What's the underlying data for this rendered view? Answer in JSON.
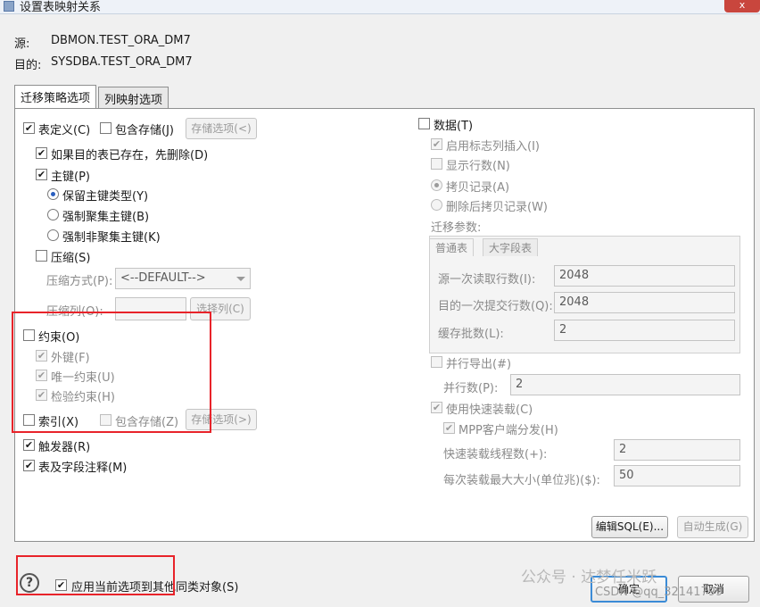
{
  "window": {
    "title": "设置表映射关系",
    "close_label": "x"
  },
  "info": {
    "source_label": "源:",
    "source_value": "DBMON.TEST_ORA_DM7",
    "target_label": "目的:",
    "target_value": "SYSDBA.TEST_ORA_DM7"
  },
  "tabs": [
    {
      "label": "迁移策略选项",
      "active": true
    },
    {
      "label": "列映射选项",
      "active": false
    }
  ],
  "left": {
    "table_def": {
      "label": "表定义(C)",
      "checked": true
    },
    "include_storage": {
      "label": "包含存储(J)",
      "checked": false
    },
    "storage_options_button": "存储选项(<)",
    "drop_if_exists": {
      "label": "如果目的表已存在，先删除(D)",
      "checked": true
    },
    "primary_key": {
      "label": "主键(P)",
      "checked": true
    },
    "pk_options": [
      {
        "label": "保留主键类型(Y)",
        "selected": true
      },
      {
        "label": "强制聚集主键(B)",
        "selected": false
      },
      {
        "label": "强制非聚集主键(K)",
        "selected": false
      }
    ],
    "compress": {
      "label": "压缩(S)",
      "checked": false
    },
    "compress_method_label": "压缩方式(P):",
    "compress_method_value": "<--DEFAULT-->",
    "compress_columns_label": "压缩列(O):",
    "select_columns_button": "选择列(C)",
    "constraints": {
      "label": "约束(O)",
      "checked": false
    },
    "constraint_items": [
      {
        "label": "外键(F)",
        "checked": true
      },
      {
        "label": "唯一约束(U)",
        "checked": true
      },
      {
        "label": "检验约束(H)",
        "checked": true
      }
    ],
    "index": {
      "label": "索引(X)",
      "checked": false
    },
    "index_include_storage": {
      "label": "包含存储(Z)",
      "checked": false
    },
    "index_storage_button": "存储选项(>)",
    "triggers": {
      "label": "触发器(R)",
      "checked": true
    },
    "comments": {
      "label": "表及字段注释(M)",
      "checked": true
    }
  },
  "right": {
    "data": {
      "label": "数据(T)",
      "checked": false
    },
    "identity_insert": {
      "label": "启用标志列插入(I)",
      "checked": true
    },
    "show_rows": {
      "label": "显示行数(N)",
      "checked": false
    },
    "copy_options": [
      {
        "label": "拷贝记录(A)",
        "selected": true
      },
      {
        "label": "删除后拷贝记录(W)",
        "selected": false
      }
    ],
    "migrate_params_label": "迁移参数:",
    "subtabs": [
      {
        "label": "普通表",
        "active": true
      },
      {
        "label": "大字段表",
        "active": false
      }
    ],
    "fetch_rows_label": "源一次读取行数(I):",
    "fetch_rows_value": "2048",
    "commit_rows_label": "目的一次提交行数(Q):",
    "commit_rows_value": "2048",
    "batch_label": "缓存批数(L):",
    "batch_value": "2",
    "parallel_export": {
      "label": "并行导出(#)",
      "checked": false
    },
    "parallel_count_label": "并行数(P):",
    "parallel_count_value": "2",
    "fast_load": {
      "label": "使用快速装载(C)",
      "checked": true
    },
    "mpp_client": {
      "label": "MPP客户端分发(H)",
      "checked": true
    },
    "fast_load_threads_label": "快速装载线程数(+):",
    "fast_load_threads_value": "2",
    "max_load_size_label": "每次装载最大大小(单位兆)($):",
    "max_load_size_value": "50"
  },
  "buttons": {
    "edit_sql": "编辑SQL(E)...",
    "auto_generate": "自动生成(G)",
    "ok": "确定",
    "cancel": "取消"
  },
  "footer": {
    "help": "?",
    "apply_all": {
      "label": "应用当前选项到其他同类对象(S)",
      "checked": true
    }
  },
  "watermarks": {
    "wechat": "公众号 · 达梦任米跃",
    "csdn": "CSDN @qq_32141799"
  },
  "colors": {
    "highlight_box": "#e8232a",
    "focus_border": "#3b8bd6"
  }
}
